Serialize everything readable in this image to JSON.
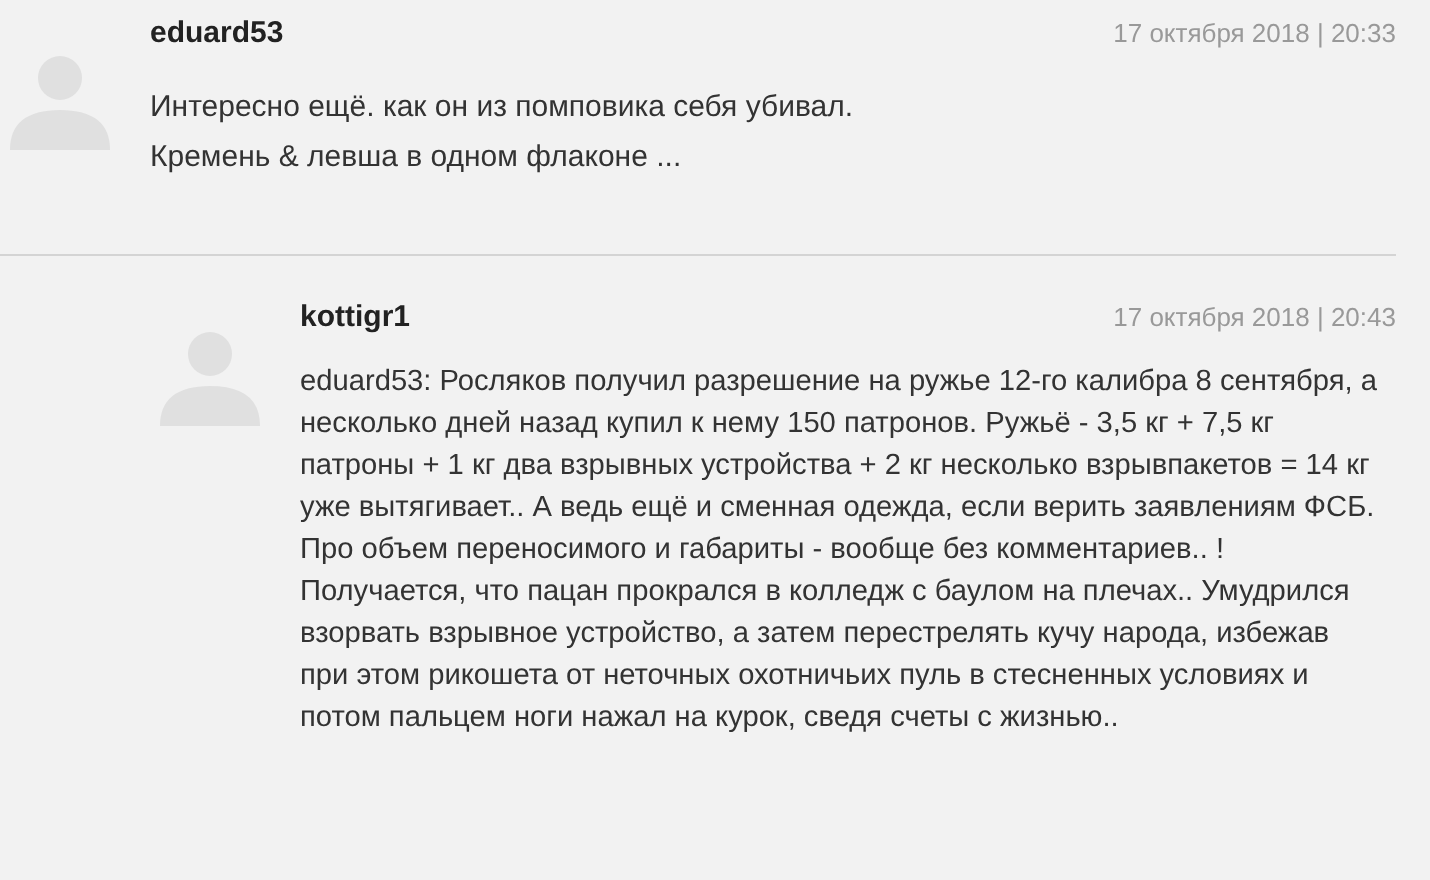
{
  "comments": [
    {
      "author": "eduard53",
      "date": "17 октября 2018 | 20:33",
      "reply": false,
      "lines": [
        "Интересно ещё. как он из помповика себя убивал.",
        "Кремень & левша в одном флаконе ..."
      ]
    },
    {
      "author": "kottigr1",
      "date": "17 октября 2018 | 20:43",
      "reply": true,
      "lines": [
        "eduard53: Росляков получил разрешение на ружье 12-го калибра 8 сентября, а",
        "несколько дней назад купил к нему 150 патронов. Ружьё - 3,5 кг + 7,5 кг",
        "патроны + 1 кг два взрывных устройства + 2 кг несколько взрывпакетов = 14 кг",
        "уже вытягивает.. А ведь ещё и сменная одежда, если верить заявлениям ФСБ.",
        "Про объем переносимого и габариты - вообще без комментариев.. !",
        "Получается, что пацан прокрался в колледж с баулом на плечах.. Умудрился",
        "взорвать взрывное устройство, а затем перестрелять кучу народа, избежав",
        "при этом рикошета от неточных охотничьих пуль в стесненных условиях и",
        "потом пальцем ноги нажал на курок, сведя счеты с жизнью.."
      ]
    }
  ]
}
